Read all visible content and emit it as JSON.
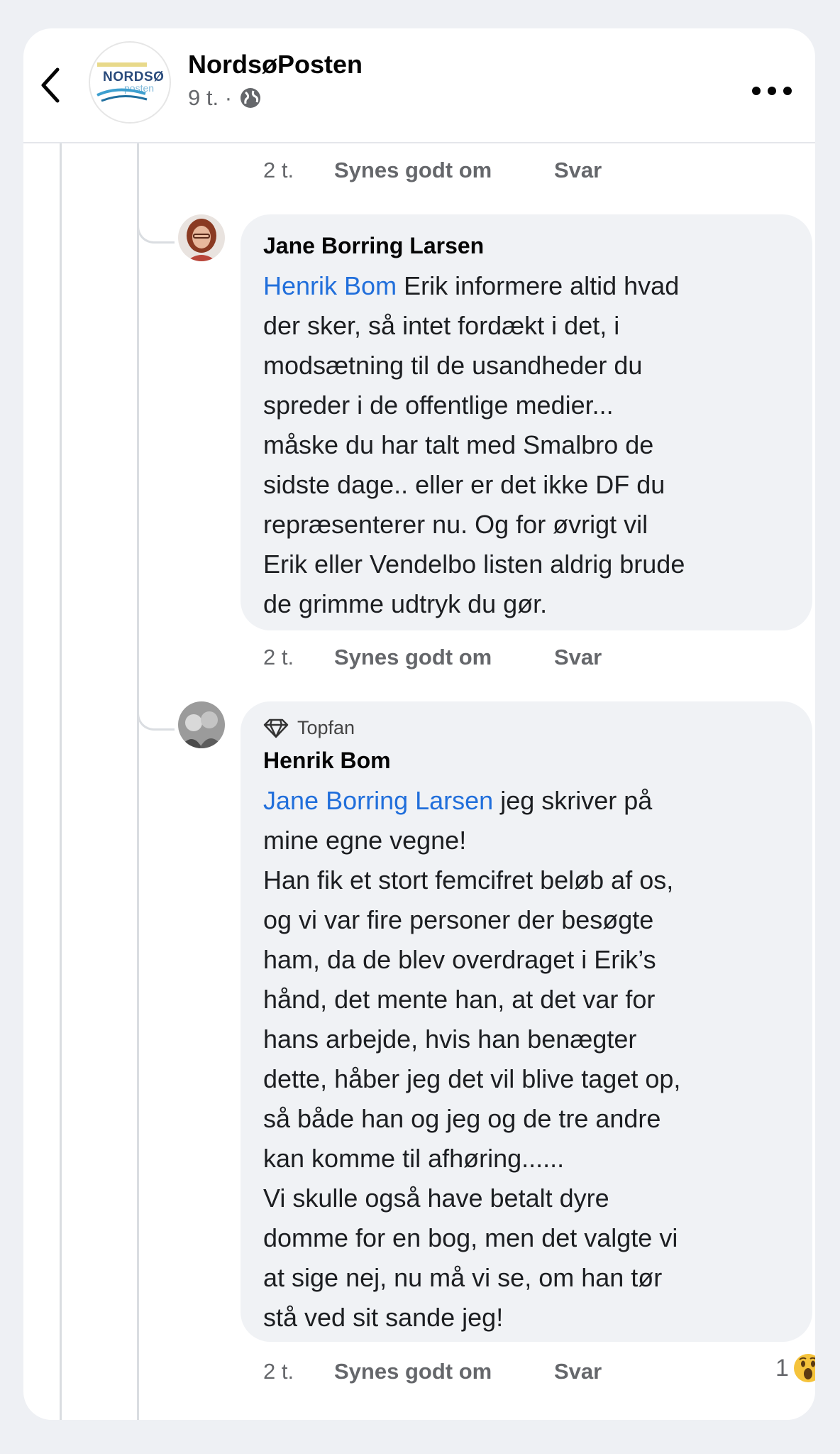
{
  "header": {
    "page_name": "NordsøPosten",
    "logo_text_top": "NORDSØ",
    "logo_text_bottom": "posten",
    "meta_time": "9 t. ·",
    "icons": {
      "back": "back-chevron-icon",
      "privacy": "globe-icon",
      "more": "more-icon"
    }
  },
  "top_actions": {
    "time": "2 t.",
    "like": "Synes godt om",
    "reply": "Svar"
  },
  "comments": [
    {
      "author": "Jane Borring Larsen",
      "mention": "Henrik Bom",
      "text": " Erik informere altid hvad\nder sker, så intet fordækt i det, i\nmodsætning til de usandheder du\nspreder i de offentlige medier...\nmåske du har talt med Smalbro de\nsidste dage.. eller er det ikke DF du\nrepræsenterer nu. Og for øvrigt vil\nErik eller Vendelbo listen aldrig brude\nde grimme udtryk du gør.",
      "time": "2 t.",
      "like": "Synes godt om",
      "reply": "Svar"
    },
    {
      "badge": "Topfan",
      "author": "Henrik Bom",
      "mention": "Jane Borring Larsen",
      "text": " jeg skriver på\nmine egne vegne!\nHan fik et stort femcifret beløb af os,\nog vi var fire personer der besøgte\nham, da de blev overdraget i Erik’s\nhånd, det mente han, at det var for\nhans arbejde, hvis han benægter\ndette, håber jeg det vil blive taget op,\nså både han og jeg og de tre andre\nkan komme til afhøring......\nVi skulle også have betalt dyre\ndomme for en bog, men det valgte vi\nat sige nej, nu må vi se, om han tør\nstå ved sit sande jeg!",
      "time": "2 t.",
      "like": "Synes godt om",
      "reply": "Svar",
      "reaction_count": "1",
      "reaction_icon": "wow-emoji-icon"
    }
  ],
  "colors": {
    "mention": "#216fdb",
    "bubble": "#f0f2f5",
    "secondary_text": "#65676b"
  }
}
